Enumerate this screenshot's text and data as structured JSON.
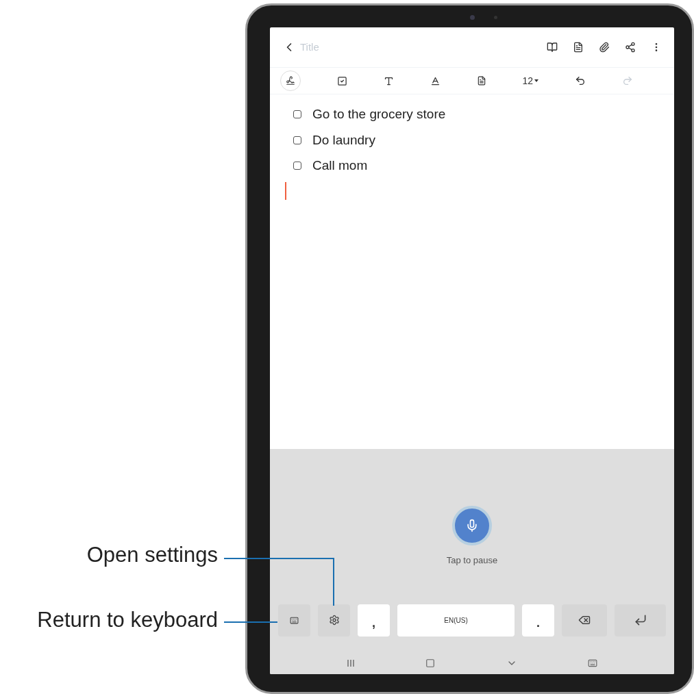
{
  "callouts": [
    {
      "label": "Open settings"
    },
    {
      "label": "Return to keyboard"
    }
  ],
  "header": {
    "title_placeholder": "Title"
  },
  "toolbar": [
    {
      "kind": "handwriting",
      "disabled": false
    },
    {
      "kind": "checkbox",
      "disabled": false
    },
    {
      "kind": "text-style",
      "disabled": false
    },
    {
      "kind": "text-format",
      "disabled": false
    },
    {
      "kind": "text-box",
      "disabled": false
    },
    {
      "kind": "font-size",
      "label": "12",
      "disabled": false
    },
    {
      "kind": "undo",
      "disabled": false
    },
    {
      "kind": "redo",
      "disabled": true
    }
  ],
  "checklist": [
    {
      "text": "Go to the grocery store",
      "checked": false
    },
    {
      "text": "Do laundry",
      "checked": false
    },
    {
      "text": "Call mom",
      "checked": false
    }
  ],
  "voice": {
    "caption": "Tap to pause"
  },
  "keyboard": [
    {
      "kind": "keyboard"
    },
    {
      "kind": "settings"
    },
    {
      "kind": "char",
      "label": ","
    },
    {
      "kind": "space",
      "label": "EN(US)"
    },
    {
      "kind": "char",
      "label": "."
    },
    {
      "kind": "backspace"
    },
    {
      "kind": "enter"
    }
  ]
}
